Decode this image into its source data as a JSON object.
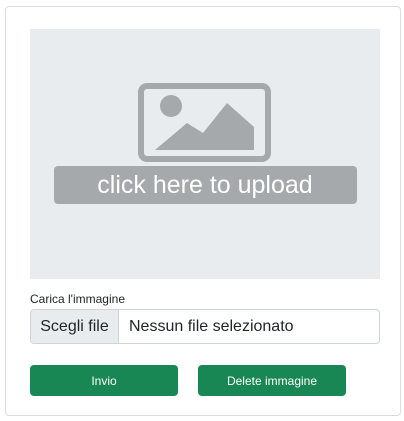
{
  "upload": {
    "overlay_text": "click here to upload",
    "icon": "image-placeholder-icon"
  },
  "form": {
    "label": "Carica l'immagine",
    "file_button_label": "Scegli file",
    "file_status": "Nessun file selezionato"
  },
  "actions": {
    "submit_label": "Invio",
    "delete_label": "Delete immagine"
  },
  "colors": {
    "accent": "#198754",
    "upload_bg": "#e8ecef",
    "icon_gray": "#a6a9ab"
  }
}
